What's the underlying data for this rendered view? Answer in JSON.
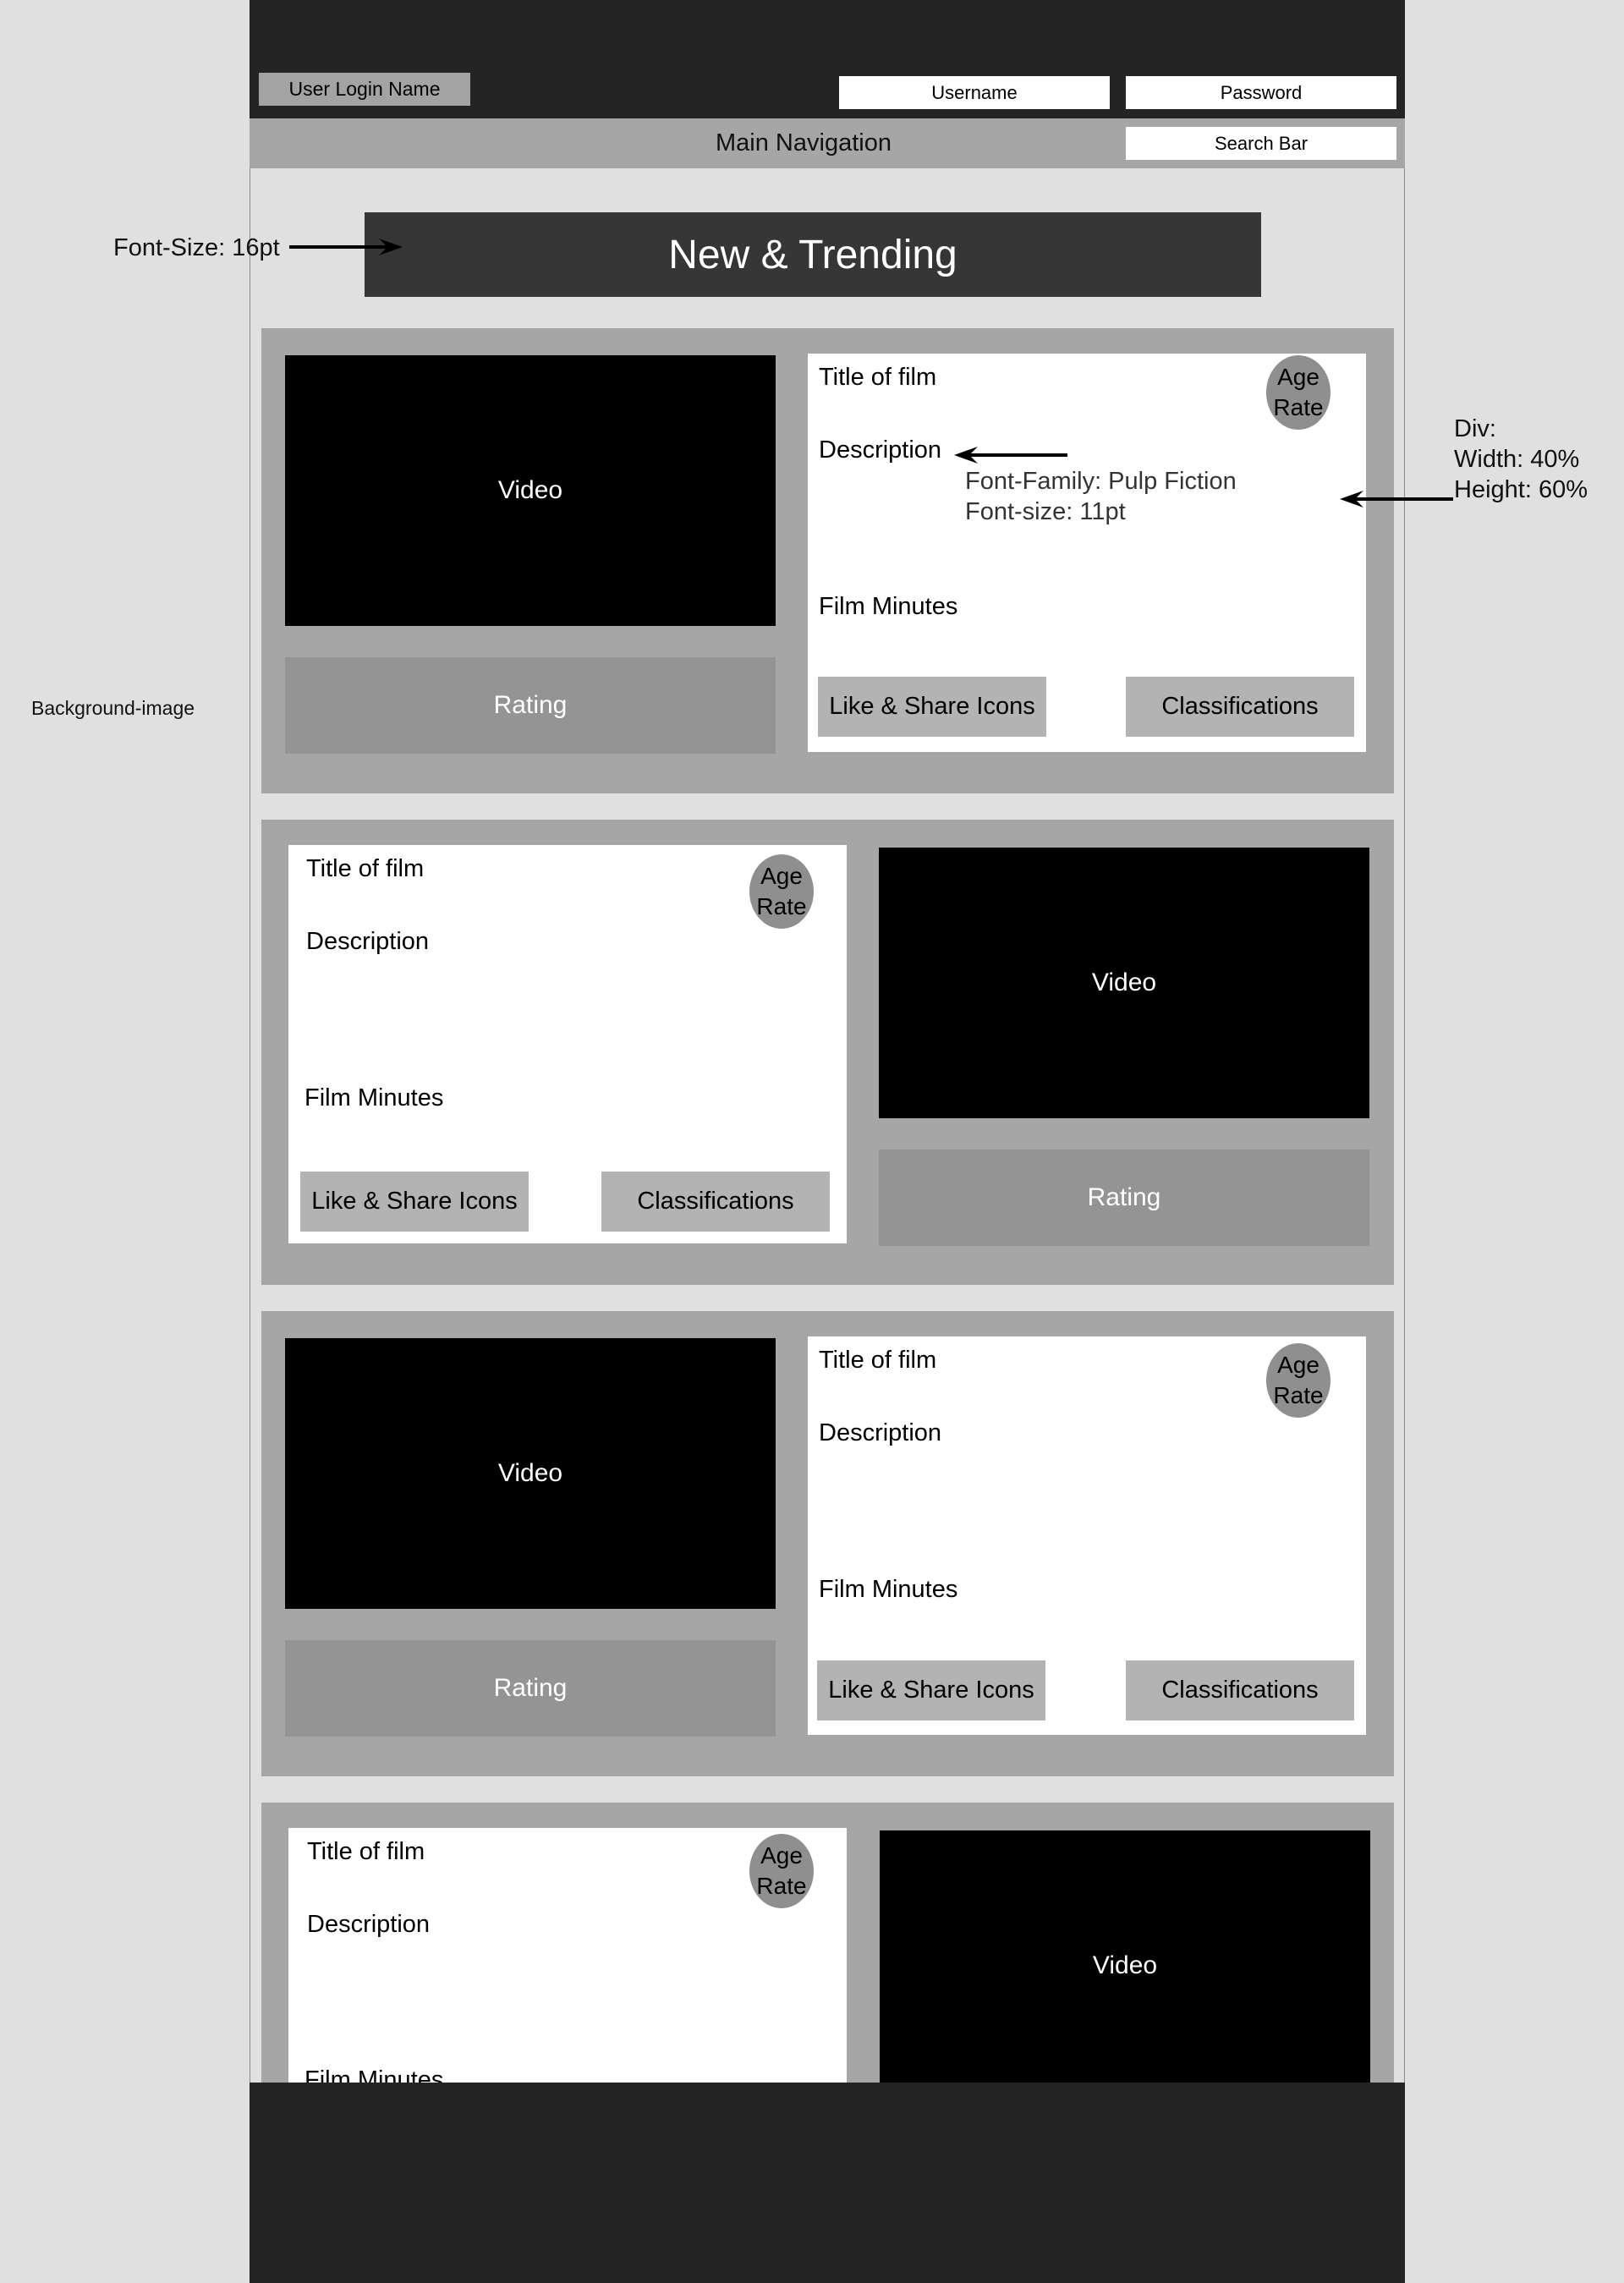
{
  "header": {
    "user_login_name": "User Login Name",
    "username_placeholder": "Username",
    "password_placeholder": "Password"
  },
  "nav": {
    "main_navigation": "Main Navigation",
    "search_bar": "Search Bar"
  },
  "banner": {
    "title": "New & Trending"
  },
  "film_card": {
    "video_label": "Video",
    "rating_label": "Rating",
    "title_label": "Title of film",
    "description_label": "Description",
    "minutes_label": "Film Minutes",
    "like_share_label": "Like & Share Icons",
    "classifications_label": "Classifications",
    "age_line1": "Age",
    "age_line2": "Rate"
  },
  "annotations": {
    "banner_font": "Font-Size: 16pt",
    "background_image": "Background-image",
    "description_font_family": "Font-Family: Pulp Fiction",
    "description_font_size": "Font-size: 11pt",
    "div_label": "Div:",
    "div_width": "Width: 40%",
    "div_height": "Height: 60%"
  },
  "colors": {
    "header_bg": "#242424",
    "nav_bg": "#a6a6a6",
    "banner_bg": "#363636",
    "section_bg": "#a6a6a6",
    "page_bg": "#e0e0e0"
  }
}
